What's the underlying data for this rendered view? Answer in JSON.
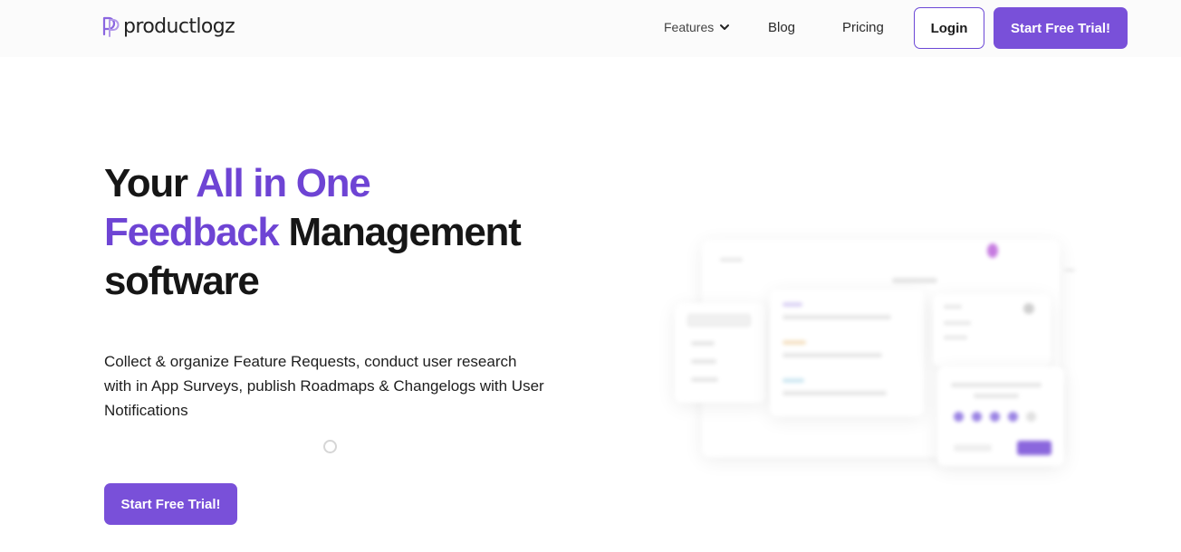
{
  "header": {
    "brand": "productlogz",
    "nav": {
      "features": "Features",
      "blog": "Blog",
      "pricing": "Pricing"
    },
    "login_label": "Login",
    "trial_label": "Start Free Trial!"
  },
  "hero": {
    "title_part1": "Your ",
    "title_accent1": "All in One",
    "title_accent2": "Feedback",
    "title_part2": " Management",
    "title_part3": "software",
    "description": "Collect & organize Feature Requests, conduct user research with in App Surveys, publish Roadmaps & Changelogs with User Notifications",
    "cta_label": "Start Free Trial!"
  },
  "colors": {
    "accent": "#7950d9",
    "accent_text": "#6e44d4"
  },
  "icons": {
    "logo": "productlogz-logo-icon",
    "dropdown": "chevron-down-icon",
    "loading": "loading-spinner-icon"
  }
}
